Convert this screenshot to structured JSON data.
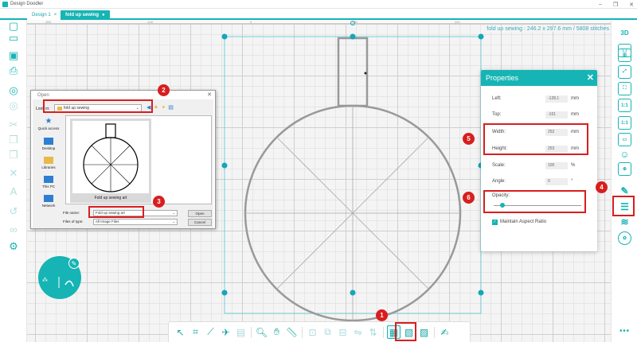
{
  "app": {
    "title": "Design Doodler",
    "controls": [
      "–",
      "❐",
      "✕"
    ]
  },
  "tabs": [
    {
      "label": "Design 1",
      "close": "×"
    },
    {
      "label": "fold up sewing",
      "marker": "●"
    }
  ],
  "ruler": {
    "labels": [
      "-200",
      "-100",
      "0",
      "100",
      "200"
    ]
  },
  "status": {
    "text": "fold up sewing : 246.2 x 297.6 mm / 5808 stitches"
  },
  "open_dialog": {
    "title": "Open",
    "look_in_label": "Look in:",
    "look_in_value": "fold up sewing",
    "places": [
      "Quick access",
      "Desktop",
      "Libraries",
      "This PC",
      "Network"
    ],
    "file_name": "Fold up sewing art",
    "file_name_label": "File name:",
    "file_name_value": "Fold up sewing art",
    "file_type_label": "Files of type:",
    "file_type_value": "All Image Files",
    "open_button": "Open",
    "cancel_button": "Cancel"
  },
  "properties": {
    "title": "Properties",
    "close": "✕",
    "left_label": "Left:",
    "left_value": "-128.1",
    "left_unit": "mm",
    "top_label": "Top:",
    "top_value": "-161",
    "top_unit": "mm",
    "width_label": "Width:",
    "width_value": "252",
    "width_unit": "mm",
    "height_label": "Height:",
    "height_value": "253",
    "height_unit": "mm",
    "scale_label": "Scale:",
    "scale_value": "100",
    "scale_unit": "%",
    "angle_label": "Angle:",
    "angle_value": "0",
    "angle_unit": "°",
    "opacity_label": "Opacity:",
    "opacity_level": 0.1,
    "aspect_label": "Maintain Aspect Ratio",
    "aspect_checked": true
  },
  "right_toolbar": {
    "top_label": "3D",
    "scale_1": "1:1",
    "scale_2": "1:1"
  },
  "annotations": {
    "badge_1": "1",
    "badge_2": "2",
    "badge_3": "3",
    "badge_4": "4",
    "badge_5": "5",
    "badge_6": "6",
    "color": "#d81e1e"
  },
  "colors": {
    "accent": "#16b4b4",
    "highlight": "#d81e1e"
  }
}
